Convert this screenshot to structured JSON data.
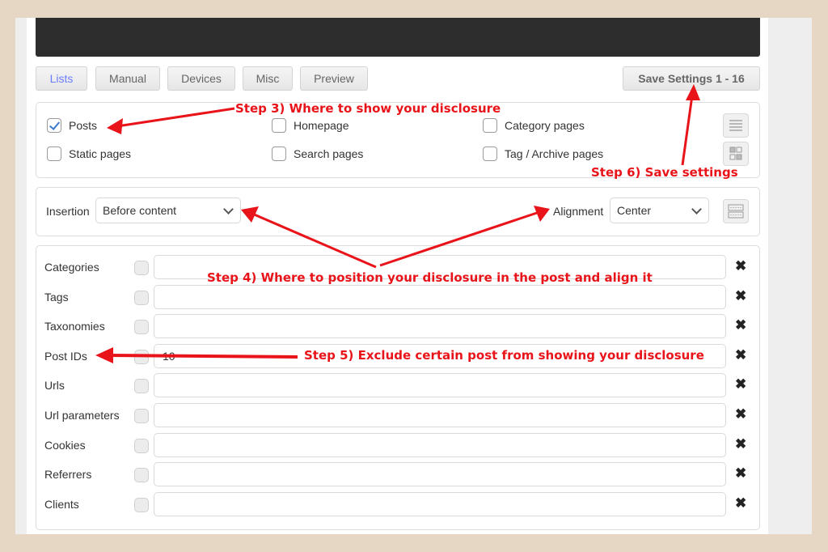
{
  "tabs": [
    {
      "label": "Lists",
      "active": true
    },
    {
      "label": "Manual",
      "active": false
    },
    {
      "label": "Devices",
      "active": false
    },
    {
      "label": "Misc",
      "active": false
    },
    {
      "label": "Preview",
      "active": false
    }
  ],
  "save_button": {
    "label": "Save Settings 1 - 16"
  },
  "display_options": {
    "checkboxes": [
      {
        "label": "Posts",
        "checked": true
      },
      {
        "label": "Homepage",
        "checked": false
      },
      {
        "label": "Category pages",
        "checked": false
      },
      {
        "label": "Static pages",
        "checked": false
      },
      {
        "label": "Search pages",
        "checked": false
      },
      {
        "label": "Tag / Archive pages",
        "checked": false
      }
    ],
    "icons": [
      "list-view-icon",
      "grid-view-icon"
    ]
  },
  "position": {
    "insertion_label": "Insertion",
    "insertion_value": "Before content",
    "alignment_label": "Alignment",
    "alignment_value": "Center",
    "icon": "layout-icon"
  },
  "exclusions": {
    "rows": [
      {
        "label": "Categories",
        "value": ""
      },
      {
        "label": "Tags",
        "value": ""
      },
      {
        "label": "Taxonomies",
        "value": ""
      },
      {
        "label": "Post IDs",
        "value": "10"
      },
      {
        "label": "Urls",
        "value": ""
      },
      {
        "label": "Url parameters",
        "value": ""
      },
      {
        "label": "Cookies",
        "value": ""
      },
      {
        "label": "Referrers",
        "value": ""
      },
      {
        "label": "Clients",
        "value": ""
      }
    ],
    "remove_icon": "close-x-icon"
  },
  "annotations": {
    "step3": "Step 3) Where to show your disclosure",
    "step4": "Step 4) Where to position your disclosure in the post and align it",
    "step5": "Step 5) Exclude certain post from showing your disclosure",
    "step6": "Step 6) Save settings"
  },
  "colors": {
    "annotation_red": "#e8141a",
    "active_tab": "#6b7cff",
    "background": "#e5d7c3",
    "topbar": "#2d2d2d"
  }
}
